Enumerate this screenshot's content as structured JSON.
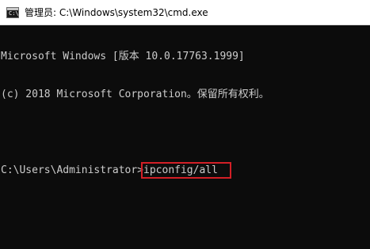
{
  "window": {
    "title": "管理员: C:\\Windows\\system32\\cmd.exe",
    "icon": "cmd-icon"
  },
  "console": {
    "banner_line1": "Microsoft Windows [版本 10.0.17763.1999]",
    "banner_line2": "(c) 2018 Microsoft Corporation。保留所有权利。",
    "prompt": "C:\\Users\\Administrator>",
    "command": "ipconfig/all"
  },
  "colors": {
    "console_background": "#0c0c0c",
    "console_text": "#cccccc",
    "highlight_box": "#d31f26",
    "titlebar_background": "#ffffff"
  }
}
